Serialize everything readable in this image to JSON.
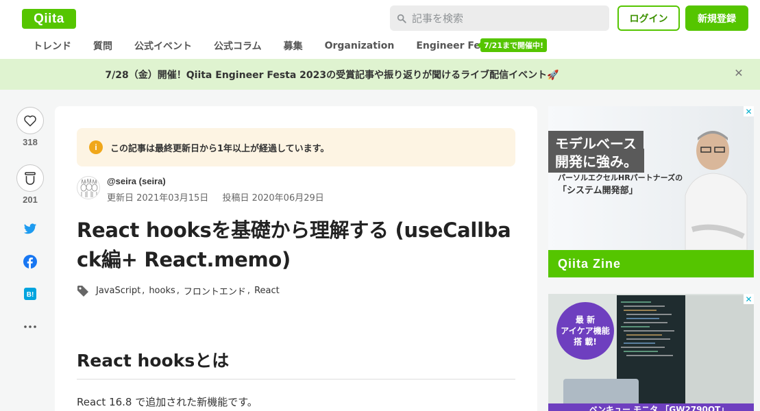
{
  "header": {
    "logo": "Qiita",
    "search_placeholder": "記事を検索",
    "login": "ログイン",
    "signup": "新規登録"
  },
  "nav": {
    "items": [
      "トレンド",
      "質問",
      "公式イベント",
      "公式コラム",
      "募集",
      "Organization",
      "Engineer Festa"
    ],
    "badge": "7/21まで開催中!"
  },
  "banner": {
    "text": "7/28（金）開催！Qiita Engineer Festa 2023の受賞記事や振り返りが聞けるライブ配信イベント🚀"
  },
  "actions": {
    "likes": "318",
    "stocks": "201"
  },
  "article": {
    "notice": "この記事は最終更新日から1年以上が経過しています。",
    "author": "@seira (seira)",
    "updated": "更新日 2021年03月15日",
    "posted": "投稿日 2020年06月29日",
    "title": "React hooksを基礎から理解する (useCallback編+ React.memo)",
    "tags": [
      "JavaScript",
      "hooks",
      "フロントエンド",
      "React"
    ],
    "section_heading": "React hooksとは",
    "paragraph": "React 16.8 で追加された新機能です。"
  },
  "ads": {
    "ad1": {
      "headline1": "モデルベース",
      "headline2": "開発に強み。",
      "sub1": "パーソルエクセルHRパートナーズの",
      "sub2": "「システム開発部」",
      "footer": "Qiita Zine"
    },
    "ad2": {
      "circle_line1": "最 新",
      "circle_line2": "アイケア機能",
      "circle_line3": "搭 載!",
      "footer": "ベンキュー モニタ 「GW2790QT」"
    }
  },
  "colors": {
    "brand": "#55c500",
    "banner_bg": "#dff3d0",
    "notice_bg": "#fdf4e3",
    "notice_icon": "#f0a71a",
    "twitter": "#1d9bf0",
    "facebook": "#1877f2",
    "hatena": "#00a4de"
  }
}
